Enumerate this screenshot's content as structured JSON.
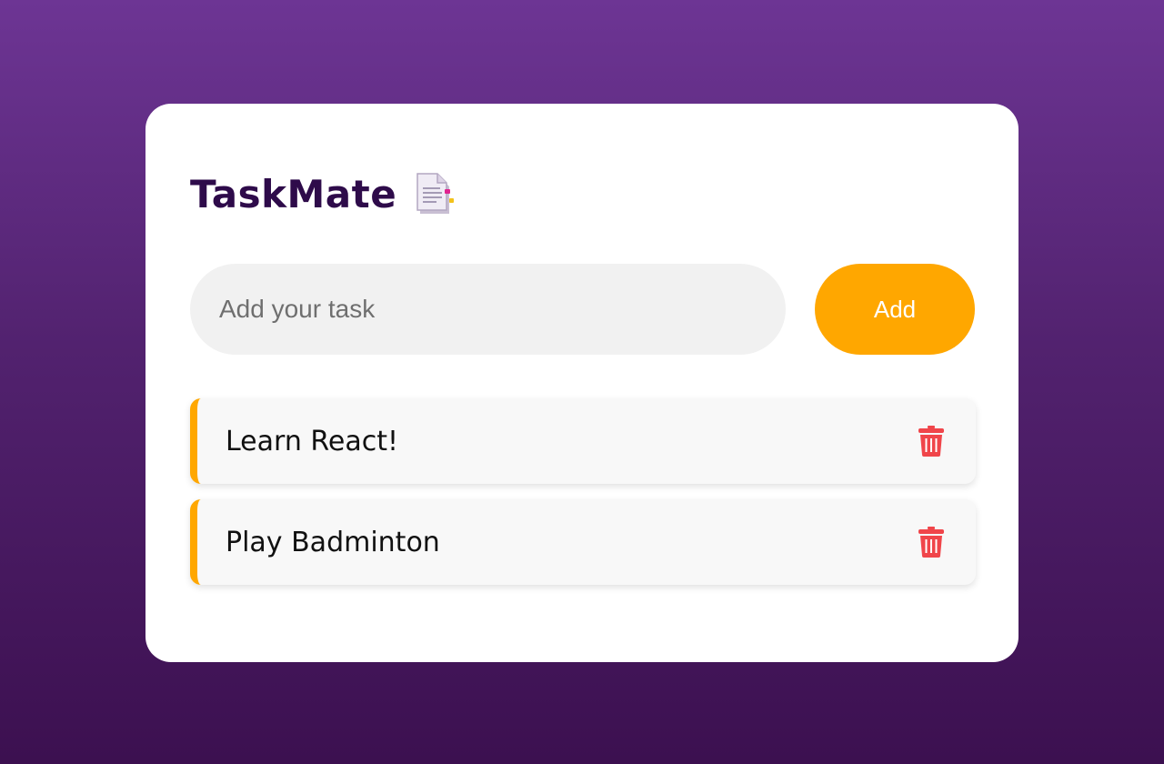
{
  "app": {
    "title": "TaskMate",
    "title_icon": "document-icon"
  },
  "input": {
    "placeholder": "Add your task",
    "value": ""
  },
  "add_button": {
    "label": "Add"
  },
  "tasks": [
    {
      "label": "Learn React!",
      "delete_icon": "trash-icon"
    },
    {
      "label": "Play Badminton",
      "delete_icon": "trash-icon"
    }
  ],
  "colors": {
    "accent": "#ffa700",
    "title": "#2e0b4a",
    "delete": "#f0454a",
    "background_top": "#6d3594",
    "background_bottom": "#3c1050"
  }
}
